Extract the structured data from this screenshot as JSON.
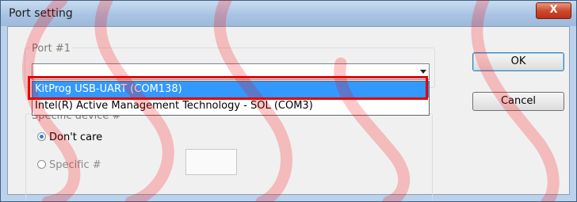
{
  "window": {
    "title": "Port setting",
    "close_label": "X"
  },
  "port_group": {
    "legend": "Port #1",
    "selected_value": "",
    "options": [
      "KitProg USB-UART (COM138)",
      "Intel(R) Active Management Technology - SOL (COM3)"
    ]
  },
  "specific_group": {
    "legend": "Specific device #",
    "radio_dont_care": "Don't care",
    "radio_specific": "Specific #",
    "specific_value": ""
  },
  "buttons": {
    "ok": "OK",
    "cancel": "Cancel"
  },
  "colors": {
    "highlight_box": "#e30000",
    "selection": "#3399ff",
    "watermark": "#ff0000"
  }
}
